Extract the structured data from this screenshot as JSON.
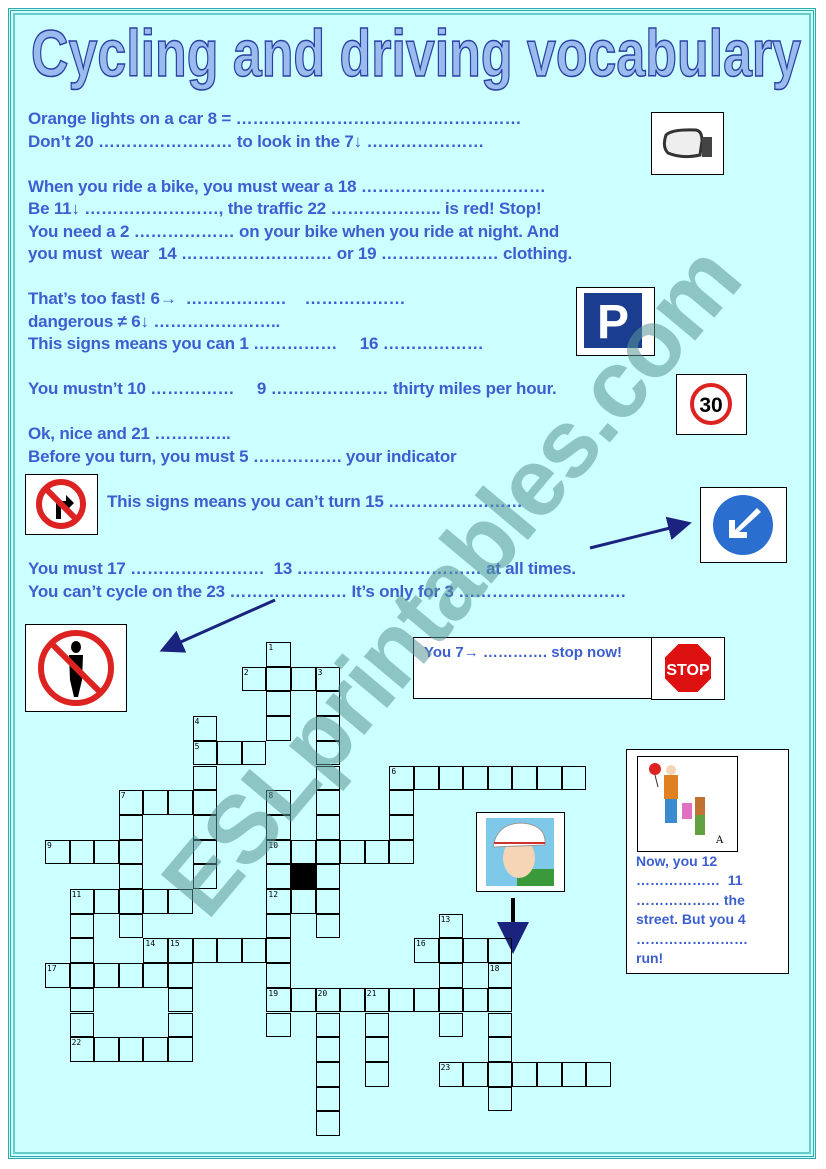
{
  "title": "Cycling and driving vocabulary",
  "watermark": "ESLprintables.com",
  "lines": [
    "Orange lights on a car 8 = ……………………………………………",
    "Don’t 20 …………………… to look in the 7↓ …………………",
    "When you ride a bike, you must wear a 18 ……………………………",
    "Be 11↓ ……………………, the traffic 22 ……………….. is red! Stop!",
    "You need a 2 ……………… on your bike when you ride at night. And",
    "you must  wear  14 ……………………… or 19 ………………… clothing.",
    "That’s too fast! 6→  ………………    ………………",
    "dangerous ≠ 6↓ …………………..",
    "This signs means you can 1 ……………     16 ………………",
    "You mustn’t 10 ……………     9 ………………… thirty miles per hour.",
    "Ok, nice and 21 …………..",
    "Before you turn, you must 5 ……………. your indicator",
    "This signs means you can’t turn 15 ……………………",
    "You must 17 ……………………  13 …………………………… at all times.",
    "You can’t cycle on the 23 ………………… It’s only for 3 …………………………"
  ],
  "stop_box": {
    "text": "You 7→ …………. stop now!",
    "sign_text": "STOP"
  },
  "lollipop_box": {
    "lines": [
      "Now, you 12",
      "………………  11",
      "……………… the",
      "street. But you 4",
      "……………………",
      "run!"
    ],
    "image_label": "A"
  },
  "speed_sign": "30",
  "parking_sign": "P",
  "crossword": {
    "numbers": [
      "1",
      "2",
      "3",
      "4",
      "5",
      "6",
      "7",
      "8",
      "9",
      "10",
      "11",
      "12",
      "13",
      "14",
      "15",
      "16",
      "17",
      "18",
      "19",
      "20",
      "21",
      "22",
      "23"
    ]
  },
  "colors": {
    "background": "#ccffff",
    "text": "#3b5fd0",
    "title_fill": "#99bbee",
    "title_stroke": "#2a3fa0"
  }
}
